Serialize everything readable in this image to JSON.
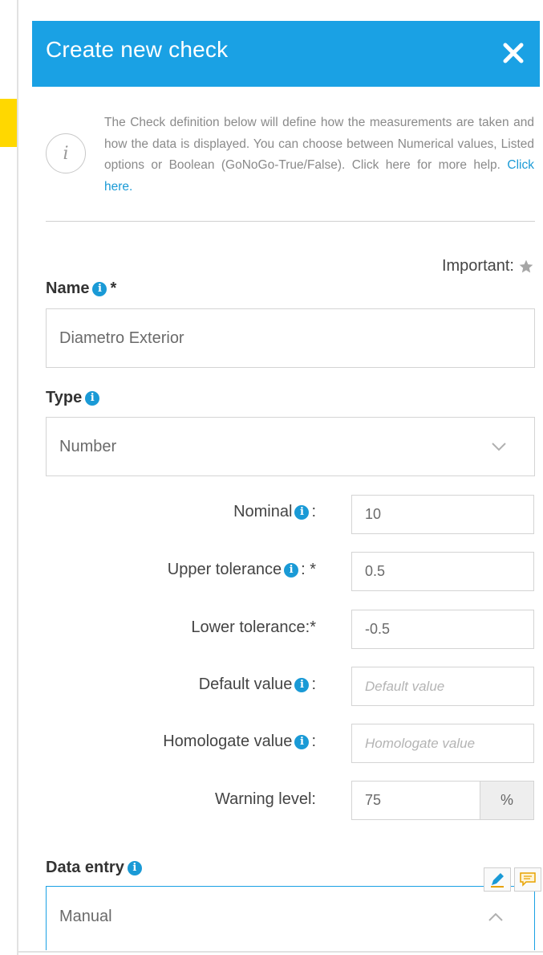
{
  "dialog": {
    "title": "Create new check",
    "info_text": "The Check definition below will define how the measurements are taken and how the data is displayed. You can choose between Numerical values, Listed options or Boolean (GoNoGo-True/False). Click here for more help.",
    "info_link": "Click here.",
    "important_label": "Important:"
  },
  "name_field": {
    "label": "Name",
    "required_mark": "*",
    "value": "Diametro Exterior"
  },
  "type_field": {
    "label": "Type",
    "value": "Number"
  },
  "rows": {
    "nominal": {
      "label": "Nominal",
      "suffix": ":",
      "value": "10"
    },
    "upper_tolerance": {
      "label": "Upper tolerance",
      "suffix": ": *",
      "value": "0.5"
    },
    "lower_tolerance": {
      "label": "Lower tolerance:*",
      "value": "-0.5"
    },
    "default_value": {
      "label": "Default value",
      "suffix": ":",
      "placeholder": "Default value"
    },
    "homologate_value": {
      "label": "Homologate value",
      "suffix": ":",
      "placeholder": "Homologate value"
    },
    "warning_level": {
      "label": "Warning level:",
      "value": "75",
      "unit": "%"
    }
  },
  "data_entry": {
    "label": "Data entry",
    "value": "Manual"
  },
  "info_glyph": "i",
  "colors": {
    "header": "#1aa1e4",
    "accent": "#1a9ad6",
    "highlight": "#ffd800"
  },
  "icons": [
    "close-icon",
    "info-circle-icon",
    "star-icon",
    "chevron-down-icon",
    "chevron-up-icon",
    "pencil-icon",
    "comment-icon"
  ]
}
